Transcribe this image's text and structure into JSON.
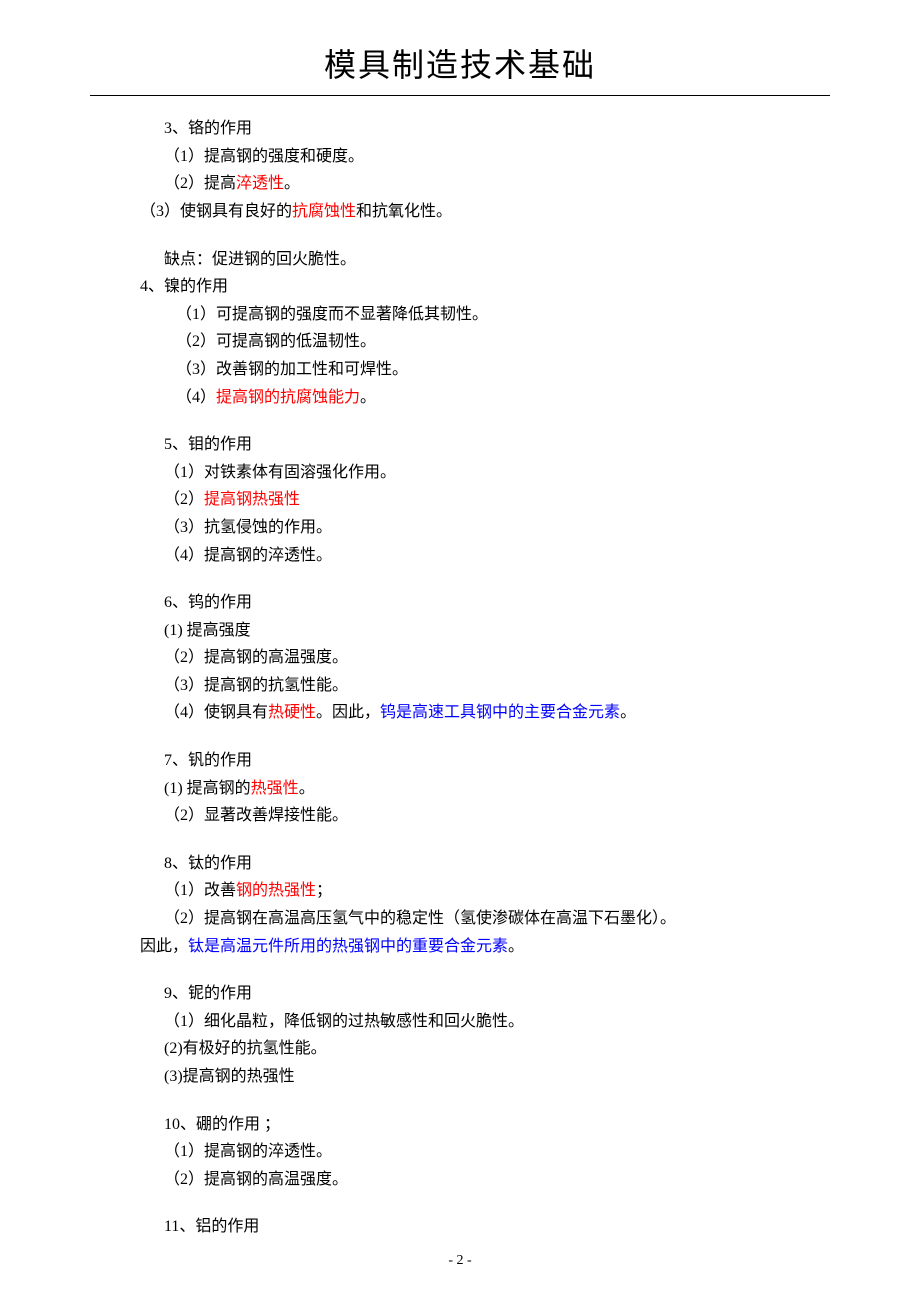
{
  "title": "模具制造技术基础",
  "footer": "- 2 -",
  "lines": [
    {
      "indent": 1,
      "segments": [
        {
          "t": "3、铬的作用"
        }
      ]
    },
    {
      "indent": 1,
      "segments": [
        {
          "t": "（1）提高钢的强度和硬度。"
        }
      ]
    },
    {
      "indent": 1,
      "segments": [
        {
          "t": "（2）提高"
        },
        {
          "t": "淬透性",
          "c": "red"
        },
        {
          "t": "。"
        }
      ]
    },
    {
      "indent": 0,
      "segments": [
        {
          "t": "（3）使钢具有良好的"
        },
        {
          "t": "抗腐蚀性",
          "c": "red"
        },
        {
          "t": "和抗氧化性。"
        }
      ]
    },
    {
      "spacer": true
    },
    {
      "indent": 1,
      "segments": [
        {
          "t": "缺点：促进钢的回火脆性。"
        }
      ]
    },
    {
      "indent": 0,
      "segments": [
        {
          "t": "4、镍的作用"
        }
      ]
    },
    {
      "indent": 2,
      "segments": [
        {
          "t": "（1）可提高钢的强度而不显著降低其韧性。"
        }
      ]
    },
    {
      "indent": 2,
      "segments": [
        {
          "t": "（2）可提高钢的低温韧性。"
        }
      ]
    },
    {
      "indent": 2,
      "segments": [
        {
          "t": "（3）改善钢的加工性和可焊性。"
        }
      ]
    },
    {
      "indent": 2,
      "segments": [
        {
          "t": "（4）"
        },
        {
          "t": "提高钢的抗腐蚀能力",
          "c": "red"
        },
        {
          "t": "。"
        }
      ]
    },
    {
      "spacer": true
    },
    {
      "indent": 1,
      "segments": [
        {
          "t": "5、钼的作用"
        }
      ]
    },
    {
      "indent": 1,
      "segments": [
        {
          "t": "（1）对铁素体有固溶强化作用。"
        }
      ]
    },
    {
      "indent": 1,
      "segments": [
        {
          "t": "（2）"
        },
        {
          "t": "提高钢热强性",
          "c": "red"
        }
      ]
    },
    {
      "indent": 1,
      "segments": [
        {
          "t": "（3）抗氢侵蚀的作用。"
        }
      ]
    },
    {
      "indent": 1,
      "segments": [
        {
          "t": "（4）提高钢的淬透性。"
        }
      ]
    },
    {
      "spacer": true
    },
    {
      "indent": 1,
      "segments": [
        {
          "t": "6、钨的作用"
        }
      ]
    },
    {
      "indent": 1,
      "segments": [
        {
          "t": "(1) 提高强度"
        }
      ]
    },
    {
      "indent": 1,
      "segments": [
        {
          "t": "（2）提高钢的高温强度。"
        }
      ]
    },
    {
      "indent": 1,
      "segments": [
        {
          "t": "（3）提高钢的抗氢性能。"
        }
      ]
    },
    {
      "indent": 1,
      "segments": [
        {
          "t": "（4）使钢具有"
        },
        {
          "t": "热硬性",
          "c": "red"
        },
        {
          "t": "。因此，"
        },
        {
          "t": "钨是高速工具钢中的主要合金元素",
          "c": "blue"
        },
        {
          "t": "。"
        }
      ]
    },
    {
      "spacer": true
    },
    {
      "indent": 1,
      "segments": [
        {
          "t": "7、钒的作用"
        }
      ]
    },
    {
      "indent": 1,
      "segments": [
        {
          "t": "(1) 提高钢的"
        },
        {
          "t": "热强性",
          "c": "red"
        },
        {
          "t": "。"
        }
      ]
    },
    {
      "indent": 1,
      "segments": [
        {
          "t": "（2）显著改善焊接性能。"
        }
      ]
    },
    {
      "spacer": true
    },
    {
      "indent": 1,
      "segments": [
        {
          "t": "8、钛的作用"
        }
      ]
    },
    {
      "indent": 1,
      "segments": [
        {
          "t": "（1）改善"
        },
        {
          "t": "钢的热强性",
          "c": "red"
        },
        {
          "t": "；"
        }
      ]
    },
    {
      "indent": 1,
      "segments": [
        {
          "t": "（2）提高钢在高温高压氢气中的稳定性（氢使渗碳体在高温下石墨化）。"
        }
      ]
    },
    {
      "indent": 0,
      "segments": [
        {
          "t": "因此，"
        },
        {
          "t": "钛是高温元件所用的热强钢中的重要合金元素",
          "c": "blue"
        },
        {
          "t": "。"
        }
      ]
    },
    {
      "spacer": true
    },
    {
      "indent": 1,
      "segments": [
        {
          "t": "9、铌的作用"
        }
      ]
    },
    {
      "indent": 1,
      "segments": [
        {
          "t": "（1）细化晶粒，降低钢的过热敏感性和回火脆性。"
        }
      ]
    },
    {
      "indent": 1,
      "segments": [
        {
          "t": "(2)有极好的抗氢性能。"
        }
      ]
    },
    {
      "indent": 1,
      "segments": [
        {
          "t": "(3)提高钢的热强性"
        }
      ]
    },
    {
      "spacer": true
    },
    {
      "indent": 1,
      "segments": [
        {
          "t": "10、硼的作用 ；"
        }
      ]
    },
    {
      "indent": 1,
      "segments": [
        {
          "t": "（1）提高钢的淬透性。"
        }
      ]
    },
    {
      "indent": 1,
      "segments": [
        {
          "t": "（2）提高钢的高温强度。"
        }
      ]
    },
    {
      "spacer": true
    },
    {
      "indent": 1,
      "segments": [
        {
          "t": "11、铝的作用"
        }
      ]
    }
  ]
}
